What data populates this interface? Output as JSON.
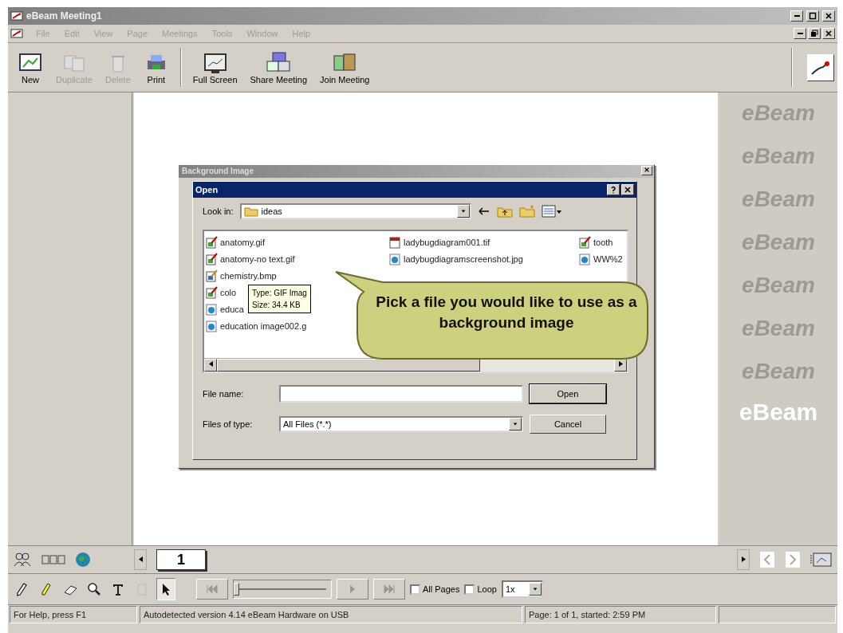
{
  "window": {
    "title": "eBeam Meeting1"
  },
  "menu": [
    {
      "label": "File",
      "disabled": true
    },
    {
      "label": "Edit",
      "disabled": true
    },
    {
      "label": "View",
      "disabled": true
    },
    {
      "label": "Page",
      "disabled": true
    },
    {
      "label": "Meetings",
      "disabled": true
    },
    {
      "label": "Tools",
      "disabled": true
    },
    {
      "label": "Window",
      "disabled": true
    },
    {
      "label": "Help",
      "disabled": true
    }
  ],
  "toolbar": [
    {
      "label": "New",
      "kind": "new",
      "disabled": false
    },
    {
      "label": "Duplicate",
      "kind": "duplicate",
      "disabled": true
    },
    {
      "label": "Delete",
      "kind": "delete",
      "disabled": true
    },
    {
      "label": "Print",
      "kind": "print",
      "disabled": false
    },
    {
      "label": "Full Screen",
      "kind": "fullscreen",
      "disabled": false
    },
    {
      "label": "Share Meeting",
      "kind": "share",
      "disabled": false
    },
    {
      "label": "Join Meeting",
      "kind": "join",
      "disabled": false
    }
  ],
  "side_logos": [
    "eBeam",
    "eBeam",
    "eBeam",
    "eBeam",
    "eBeam",
    "eBeam",
    "eBeam"
  ],
  "brand": "eBeam",
  "background_dialog": {
    "title": "Background Image"
  },
  "open_dialog": {
    "title": "Open",
    "look_in_label": "Look in:",
    "look_in_value": "ideas",
    "file_columns": [
      {
        "files": [
          {
            "name": "anatomy.gif",
            "kind": "gif"
          },
          {
            "name": "anatomy-no text.gif",
            "kind": "gif"
          },
          {
            "name": "chemistry.bmp",
            "kind": "bmp"
          },
          {
            "name": "colo",
            "kind": "gif"
          },
          {
            "name": "educa",
            "kind": "jpg"
          },
          {
            "name": "education image002.g",
            "kind": "jpg"
          }
        ]
      },
      {
        "files": [
          {
            "name": "ladybugdiagram001.tif",
            "kind": "tif"
          },
          {
            "name": "ladybugdiagramscreenshot.jpg",
            "kind": "jpg"
          }
        ]
      },
      {
        "files": [
          {
            "name": "tooth",
            "kind": "gif"
          },
          {
            "name": "WW%2",
            "kind": "jpg"
          }
        ]
      }
    ],
    "tooltip": [
      "Type: GIF Imag",
      "Size: 34.4 KB"
    ],
    "file_name_label": "File name:",
    "files_of_type_label": "Files of type:",
    "files_of_type_value": "All Files (*.*)",
    "buttons": [
      "Open",
      "Cancel"
    ]
  },
  "callout": "Pick a file you would like to use as a background image",
  "page_tabs": [
    {
      "label": "1",
      "selected": true
    }
  ],
  "tools": [
    {
      "kind": "pen",
      "selected": false
    },
    {
      "kind": "highlighter",
      "selected": false
    },
    {
      "kind": "eraser",
      "selected": false
    },
    {
      "kind": "zoom",
      "selected": false
    },
    {
      "kind": "text",
      "selected": false
    },
    {
      "kind": "clipboard",
      "selected": false
    },
    {
      "kind": "pointer",
      "selected": true
    }
  ],
  "playback": {
    "level": 0,
    "all_pages": {
      "label": "All Pages",
      "checked": false
    },
    "loop": {
      "label": "Loop",
      "checked": false
    },
    "speed": "1x"
  },
  "status_bar": [
    "For Help, press F1",
    "Autodetected version 4.14 eBeam Hardware on USB",
    "Page: 1 of 1, started: 2:59 PM"
  ]
}
